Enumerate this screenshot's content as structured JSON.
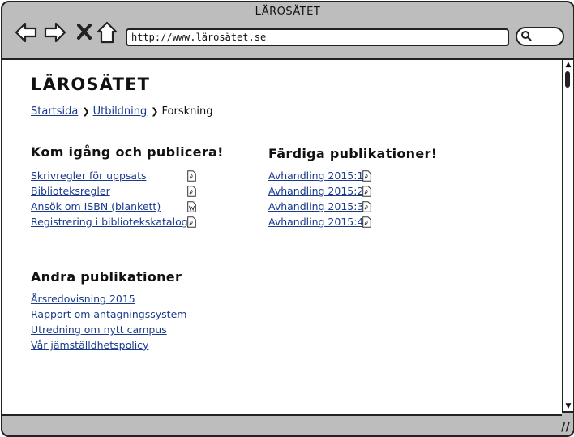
{
  "window": {
    "title": "LÄROSÄTET"
  },
  "toolbar": {
    "url": "http://www.lärosätet.se",
    "icons": {
      "back": "back-arrow-icon",
      "forward": "forward-arrow-icon",
      "stop": "close-icon",
      "home": "home-icon",
      "search": "search-icon"
    }
  },
  "page": {
    "site_title": "LÄROSÄTET",
    "breadcrumb": {
      "items": [
        "Startsida",
        "Utbildning"
      ],
      "current": "Forskning"
    },
    "sections": {
      "get_started": {
        "heading": "Kom igång och publicera!",
        "links": [
          {
            "label": "Skrivregler för uppsats",
            "icon": "pdf-icon"
          },
          {
            "label": "Biblioteksregler",
            "icon": "pdf-icon"
          },
          {
            "label": "Ansök om ISBN (blankett)",
            "icon": "word-doc-icon"
          },
          {
            "label": "Registrering i bibliotekskatalog",
            "icon": "pdf-icon"
          }
        ]
      },
      "finished": {
        "heading": "Färdiga publikationer!",
        "links": [
          {
            "label": "Avhandling 2015:1",
            "icon": "pdf-icon"
          },
          {
            "label": "Avhandling 2015:2",
            "icon": "pdf-icon"
          },
          {
            "label": "Avhandling 2015:3",
            "icon": "pdf-icon"
          },
          {
            "label": "Avhandling 2015:4",
            "icon": "pdf-icon"
          }
        ]
      },
      "other": {
        "heading": "Andra publikationer",
        "links": [
          {
            "label": "Årsredovisning 2015"
          },
          {
            "label": "Rapport om antagningssystem"
          },
          {
            "label": "Utredning om nytt campus"
          },
          {
            "label": "Vår jämställdhetspolicy"
          }
        ]
      }
    }
  }
}
